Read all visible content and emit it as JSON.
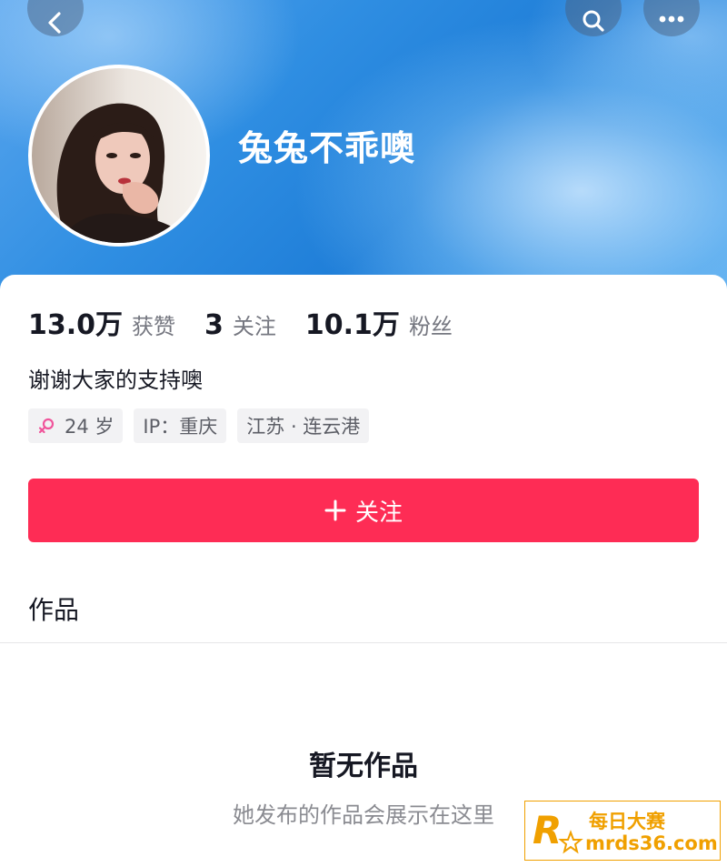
{
  "header": {
    "nickname": "兔兔不乖噢",
    "icons": {
      "back": "chevron-left-icon",
      "search": "search-icon",
      "more": "more-dots-icon"
    }
  },
  "stats": [
    {
      "value": "13.0万",
      "label": "获赞"
    },
    {
      "value": "3",
      "label": "关注"
    },
    {
      "value": "10.1万",
      "label": "粉丝"
    }
  ],
  "bio": "谢谢大家的支持噢",
  "tags": {
    "age": "24 岁",
    "ip": "IP：重庆",
    "location": "江苏 · 连云港"
  },
  "follow_button": {
    "label": "关注"
  },
  "works_section": {
    "title": "作品",
    "empty_title": "暂无作品",
    "empty_desc": "她发布的作品会展示在这里"
  },
  "watermark": {
    "line1": "每日大赛",
    "line2": "mrds36.com"
  },
  "colors": {
    "accent": "#fe2c55",
    "female_icon": "#f0559b",
    "watermark": "#f0a000"
  }
}
